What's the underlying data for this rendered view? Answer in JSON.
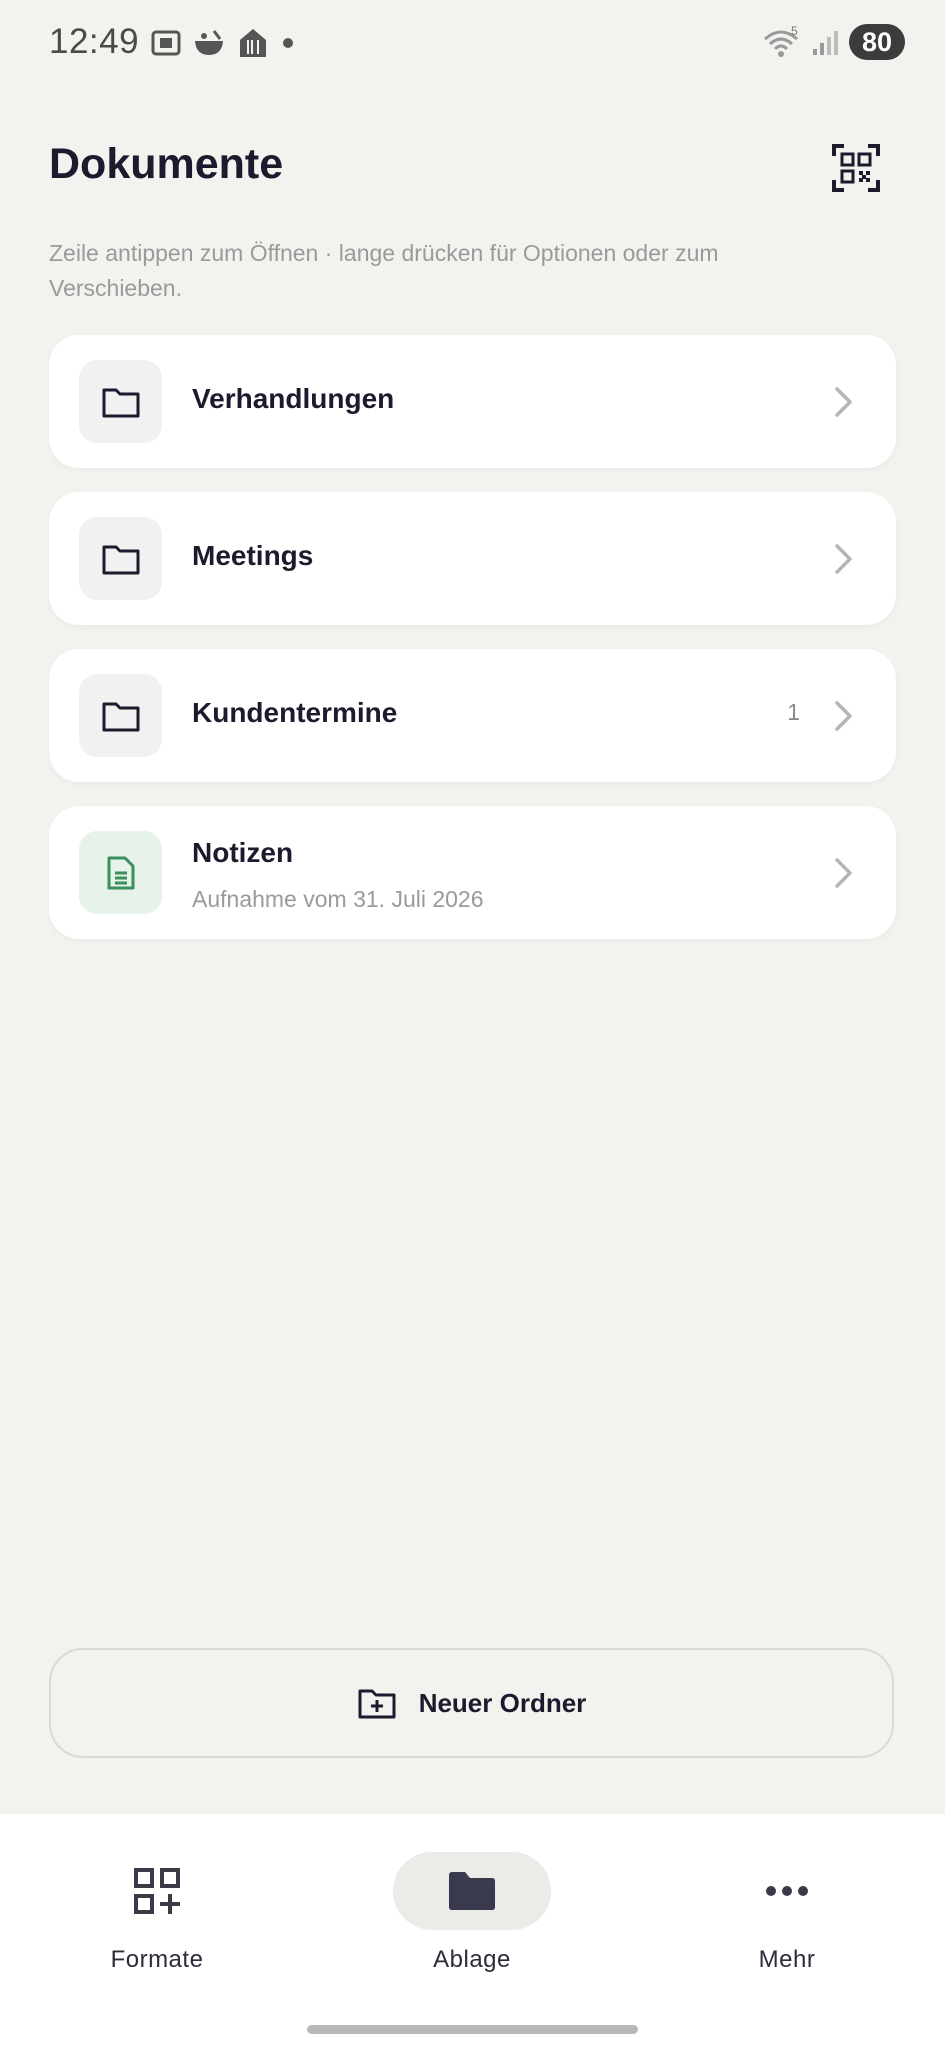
{
  "status_bar": {
    "time": "12:49",
    "battery": "80",
    "wifi_badge": "5"
  },
  "header": {
    "title": "Dokumente",
    "hint": "Zeile antippen zum Öffnen · lange drücken für Optionen oder zum Verschieben."
  },
  "items": [
    {
      "type": "folder",
      "label": "Verhandlungen",
      "count": ""
    },
    {
      "type": "folder",
      "label": "Meetings",
      "count": ""
    },
    {
      "type": "folder",
      "label": "Kundentermine",
      "count": "1"
    },
    {
      "type": "document",
      "label": "Notizen",
      "subtitle": "Aufnahme vom 31. Juli 2026"
    }
  ],
  "actions": {
    "new_folder_label": "Neuer Ordner"
  },
  "bottom_nav": {
    "items": [
      {
        "label": "Formate",
        "icon": "grid-plus-icon",
        "active": false
      },
      {
        "label": "Ablage",
        "icon": "folder-icon",
        "active": true
      },
      {
        "label": "Mehr",
        "icon": "more-dots-icon",
        "active": false
      }
    ]
  },
  "colors": {
    "background": "#f3f2ef",
    "card": "#ffffff",
    "text": "#1c1b2e",
    "muted": "#9a9a9a",
    "doc_accent": "#3a8f5c"
  }
}
